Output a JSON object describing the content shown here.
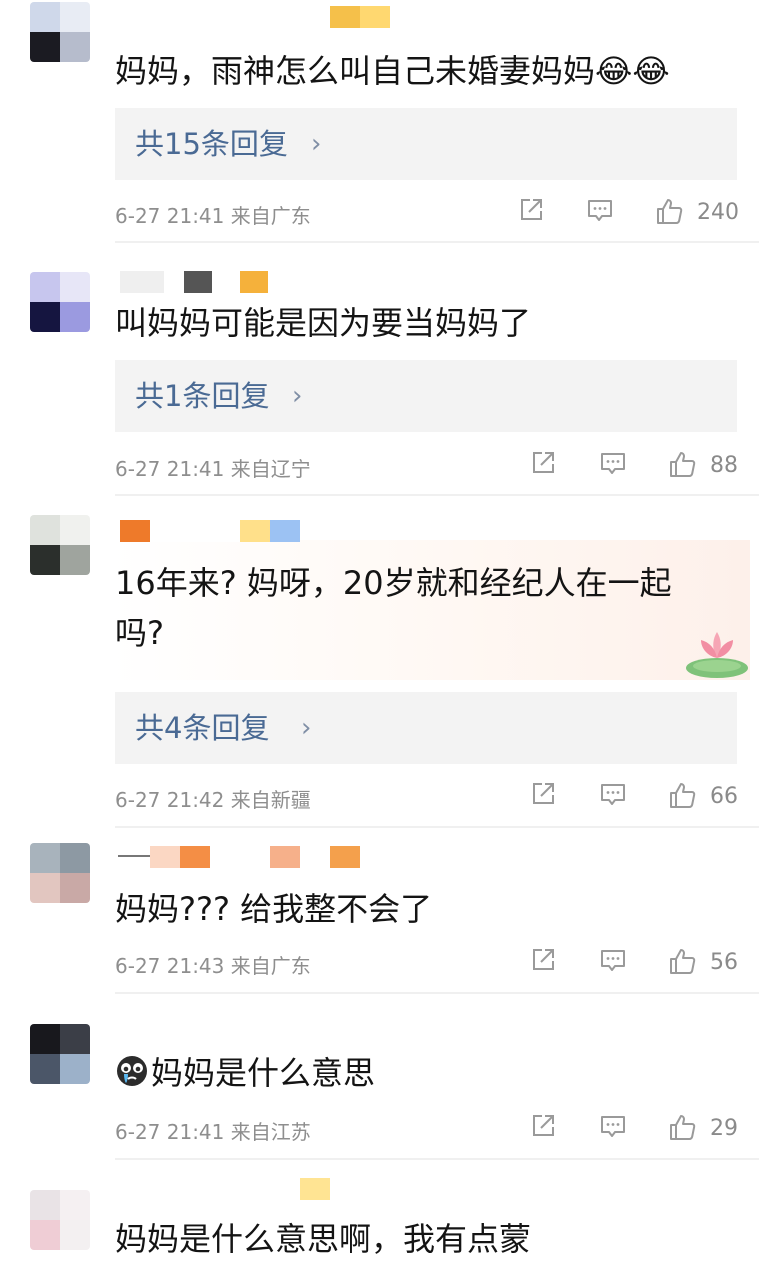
{
  "comments": [
    {
      "text": "妈妈，雨神怎么叫自己未婚妻妈妈😂😂",
      "reply_label": "共15条回复",
      "time": "6-27 21:41",
      "location": "来自广东",
      "likes": "240",
      "avatar_colors": [
        "#cfd8ea",
        "#e8ecf4",
        "#1b1b22",
        "#b6bccc"
      ],
      "name_colors": [
        "#f5c04a",
        "#ffd870"
      ]
    },
    {
      "text": "叫妈妈可能是因为要当妈妈了",
      "reply_label": "共1条回复",
      "time": "6-27 21:41",
      "location": "来自辽宁",
      "likes": "88",
      "avatar_colors": [
        "#c7c6ee",
        "#e7e6f7",
        "#151540",
        "#9b9ae0"
      ],
      "name_colors": [
        "#e9e9e9",
        "#555555",
        "#f5b13b"
      ]
    },
    {
      "text": "16年来? 妈呀，20岁就和经纪人在一起吗?",
      "reply_label": "共4条回复",
      "time": "6-27 21:42",
      "location": "来自新疆",
      "likes": "66",
      "avatar_colors": [
        "#dfe2dd",
        "#f0f1ee",
        "#2b2f2c",
        "#9fa49e"
      ],
      "name_colors": [
        "#ee7a2a",
        "#ffe08a",
        "#9cc2f3"
      ]
    },
    {
      "text": "妈妈??? 给我整不会了",
      "reply_label": "",
      "time": "6-27 21:43",
      "location": "来自广东",
      "likes": "56",
      "avatar_colors": [
        "#a8b3bc",
        "#8d99a3",
        "#e2c6c0",
        "#c9a9a6"
      ],
      "name_colors": [
        "#fbd7c3",
        "#f48e45",
        "#f6b08a",
        "#f4a04c"
      ]
    },
    {
      "text": "妈妈是什么意思",
      "reply_label": "",
      "time": "6-27 21:41",
      "location": "来自江苏",
      "likes": "29",
      "avatar_colors": [
        "#18181d",
        "#3b3e47",
        "#4b5668",
        "#9cb1c9"
      ],
      "name_colors": []
    },
    {
      "text": "妈妈是什么意思啊，我有点蒙",
      "avatar_colors": [
        "#e9e3e6",
        "#f5f0f2",
        "#efcdd5",
        "#f3f0f1"
      ],
      "name_colors": [
        "#ffe493"
      ]
    }
  ],
  "icons": {
    "share": "share-icon",
    "comment": "comment-icon",
    "like": "thumbs-up-icon",
    "chevron": "chevron-right-icon",
    "crying_emoji": "crying-face-emoji",
    "sticker": "lotus-sticker"
  },
  "colors": {
    "reply_text": "#4a6a94",
    "meta_text": "#8e8e8e",
    "reply_bg": "#f3f3f3"
  }
}
